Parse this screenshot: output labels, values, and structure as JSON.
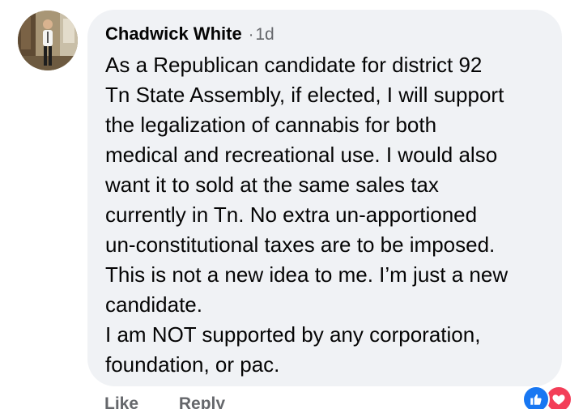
{
  "comment": {
    "author": "Chadwick White",
    "separator": "·",
    "time": "1d",
    "lines": [
      "As a Republican candidate for district 92",
      "Tn State Assembly, if elected, I will support",
      "the legalization of cannabis for both",
      "medical and recreational use. I would also",
      "want it to sold at the same sales tax",
      "currently in Tn. No extra un-apportioned",
      "un-constitutional taxes are to be imposed.",
      "This is not a new idea to me. I’m just a new",
      "candidate.",
      "I am NOT supported by any corporation,",
      "foundation, or pac."
    ]
  },
  "actions": {
    "like_label": "Like",
    "reply_label": "Reply"
  },
  "reactions": [
    "like-icon",
    "love-icon"
  ],
  "colors": {
    "bubble": "#f0f2f5",
    "text": "#050505",
    "meta": "#65676b",
    "like": "#1877f2",
    "love": "#f33e58"
  }
}
